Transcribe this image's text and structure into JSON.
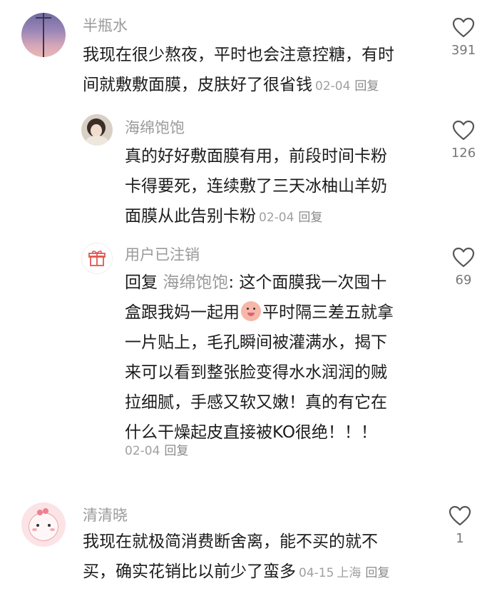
{
  "comments": [
    {
      "user": "半瓶水",
      "lines": [
        "我现在很少熬夜，平时也会注意控糖，有时",
        "间就敷敷面膜，皮肤好了很省钱"
      ],
      "date": "02-04",
      "reply": "回复",
      "likes": "391"
    },
    {
      "user": "海绵饱饱",
      "lines": [
        "真的好好敷面膜有用，前段时间卡粉",
        "卡得要死，连续敷了三天冰柚山羊奶",
        "面膜从此告别卡粉"
      ],
      "date": "02-04",
      "reply": "回复",
      "likes": "126"
    },
    {
      "user": "用户已注销",
      "reply_prefix": "回复",
      "mention": "海绵饱饱",
      "line1_after": ": 这个面膜我一次囤十",
      "line2_before": "盒跟我妈一起用",
      "line2_after": "平时隔三差五就拿",
      "lines": [
        "一片贴上，毛孔瞬间被灌满水，揭下",
        "来可以看到整张脸变得水水润润的贼",
        "拉细腻，手感又软又嫩！真的有它在",
        "什么干燥起皮直接被KO很绝！！！"
      ],
      "date": "02-04",
      "reply": "回复",
      "likes": "69"
    },
    {
      "user": "清清晓",
      "lines": [
        "我现在就极简消费断舍离，能不买的就不",
        "买，确实花销比以前少了蛮多"
      ],
      "date": "04-15",
      "location": "上海",
      "reply": "回复",
      "likes": "1"
    }
  ],
  "colors": {
    "text": "#1c1c1c",
    "muted": "#9a9a9a",
    "heart": "#555555"
  }
}
